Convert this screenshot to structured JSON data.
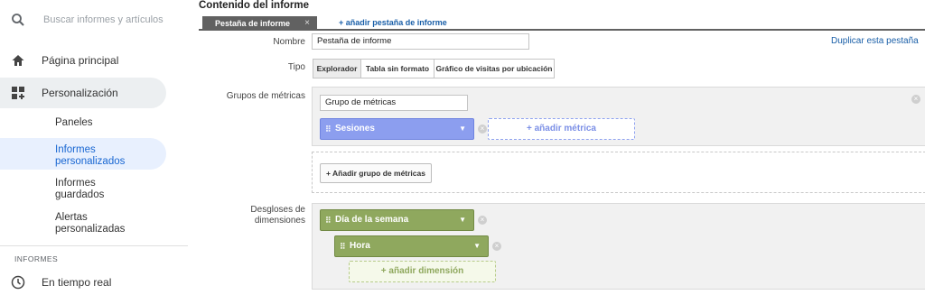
{
  "sidebar": {
    "search_placeholder": "Buscar informes y artículos",
    "home_label": "Página principal",
    "customization_label": "Personalización",
    "sub_items": [
      {
        "label": "Paneles"
      },
      {
        "label": "Informes personalizados"
      },
      {
        "label": "Informes guardados"
      },
      {
        "label": "Alertas personalizadas"
      }
    ],
    "section_label": "INFORMES",
    "realtime_label": "En tiempo real"
  },
  "main": {
    "title": "Contenido del informe",
    "tab_label": "Pestaña de informe",
    "tab_close": "×",
    "add_tab_label": "+ añadir pestaña de informe",
    "name_label": "Nombre",
    "name_value": "Pestaña de informe",
    "duplicate_label": "Duplicar esta pestaña",
    "type_label": "Tipo",
    "types": [
      "Explorador",
      "Tabla sin formato",
      "Gráfico de visitas por ubicación"
    ],
    "metric_groups_label": "Grupos de métricas",
    "metric_group_name": "Grupo de métricas",
    "metric_pill": "Sesiones",
    "add_metric_label": "+ añadir métrica",
    "add_metric_group_label": "+ Añadir grupo de métricas",
    "dimensions_label_1": "Desgloses de",
    "dimensions_label_2": "dimensiones",
    "dimension_1": "Día de la semana",
    "dimension_2": "Hora",
    "add_dimension_label": "+ añadir dimensión"
  },
  "colors": {
    "metric_blue": "#8c9eef",
    "dimension_green": "#8fa85e",
    "link_blue": "#1a5fa8",
    "active_nav": "#1967d2"
  }
}
